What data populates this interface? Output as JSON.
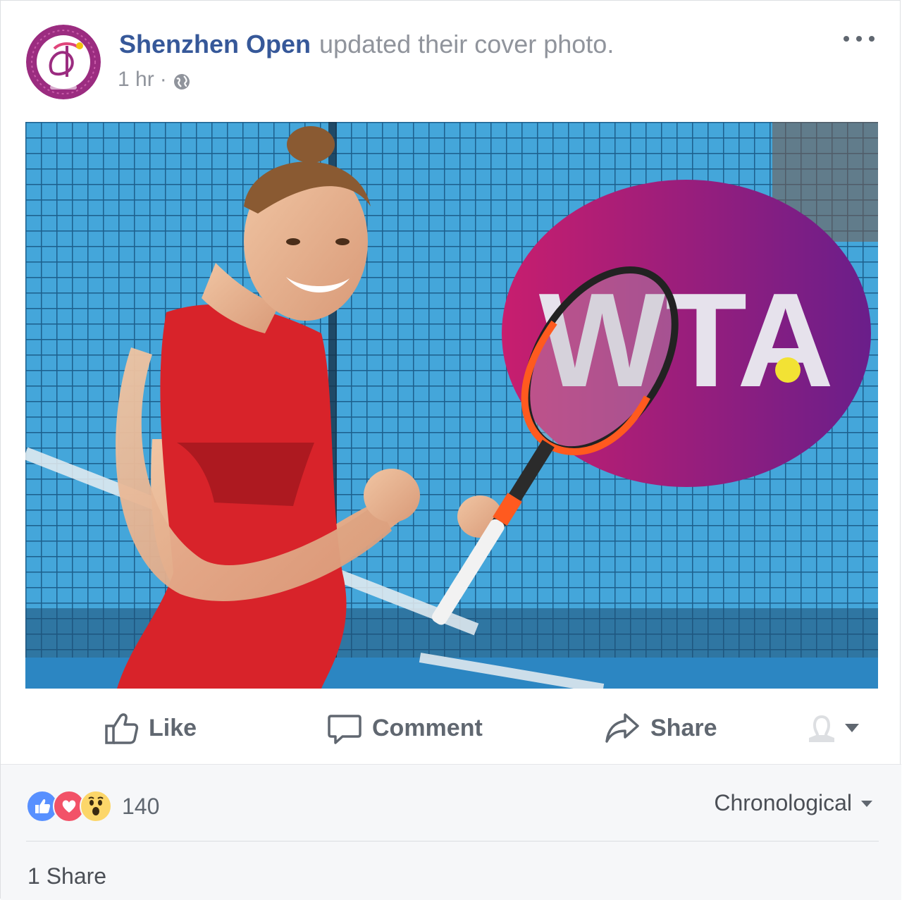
{
  "post": {
    "author": "Shenzhen Open",
    "action_text": "updated their cover photo.",
    "timestamp": "1 hr",
    "separator": "·",
    "privacy_icon": "globe-icon",
    "more_icon": "ellipsis-icon"
  },
  "photo": {
    "logo_text": "WTA",
    "description_colors": {
      "background": "#3a9ad0",
      "dress": "#d8232a",
      "logo_gradient_start": "#c81e6e",
      "logo_gradient_end": "#6a1e8a"
    }
  },
  "actions": {
    "like": "Like",
    "comment": "Comment",
    "share": "Share",
    "audience_icon": "person-silhouette-icon"
  },
  "footer": {
    "reaction_icons": [
      "like-reaction-icon",
      "love-reaction-icon",
      "wow-reaction-icon"
    ],
    "reaction_count": "140",
    "comment_order": "Chronological",
    "shares": "1 Share"
  },
  "colors": {
    "link": "#365899",
    "muted": "#90949c",
    "action": "#606770",
    "like_blue": "#5890ff",
    "love_red": "#f25268",
    "wow_yellow": "#fcd669"
  }
}
